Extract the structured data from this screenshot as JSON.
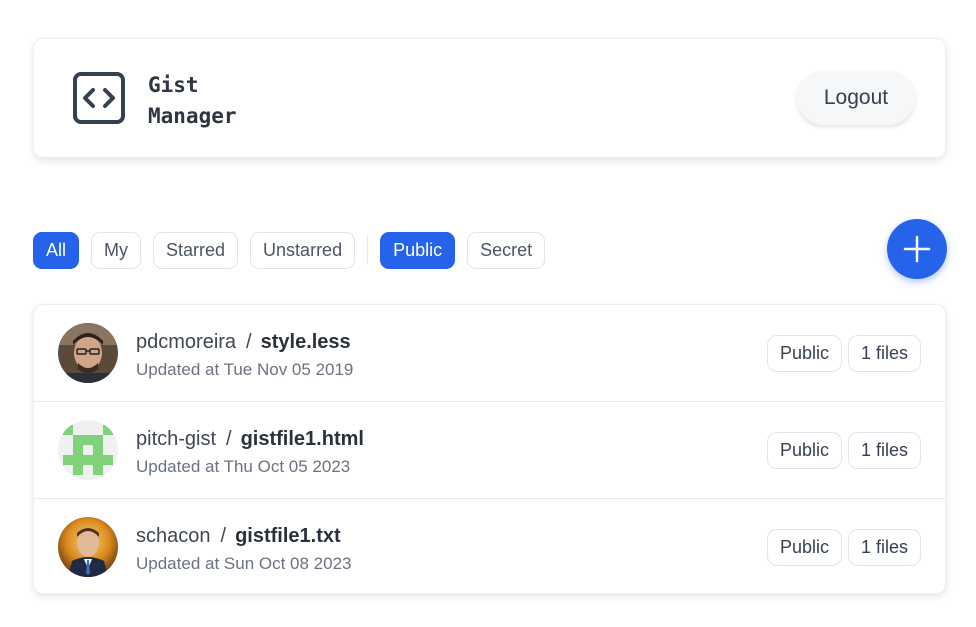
{
  "header": {
    "title": "Gist\nManager",
    "logout_label": "Logout"
  },
  "filters": {
    "group1": [
      {
        "label": "All",
        "active": true
      },
      {
        "label": "My",
        "active": false
      },
      {
        "label": "Starred",
        "active": false
      },
      {
        "label": "Unstarred",
        "active": false
      }
    ],
    "group2": [
      {
        "label": "Public",
        "active": true
      },
      {
        "label": "Secret",
        "active": false
      }
    ]
  },
  "gists": [
    {
      "owner": "pdcmoreira",
      "separator": "/",
      "filename": "style.less",
      "updated": "Updated at Tue Nov 05 2019",
      "visibility": "Public",
      "files": "1 files",
      "avatar": "photo-man-glasses"
    },
    {
      "owner": "pitch-gist",
      "separator": "/",
      "filename": "gistfile1.html",
      "updated": "Updated at Thu Oct 05 2023",
      "visibility": "Public",
      "files": "1 files",
      "avatar": "identicon-green"
    },
    {
      "owner": "schacon",
      "separator": "/",
      "filename": "gistfile1.txt",
      "updated": "Updated at Sun Oct 08 2023",
      "visibility": "Public",
      "files": "1 files",
      "avatar": "photo-man-suit"
    }
  ],
  "colors": {
    "accent": "#2563eb",
    "identicon": "#7fd27a"
  },
  "icons": {
    "logo": "code-brackets-icon",
    "add": "plus-icon"
  }
}
